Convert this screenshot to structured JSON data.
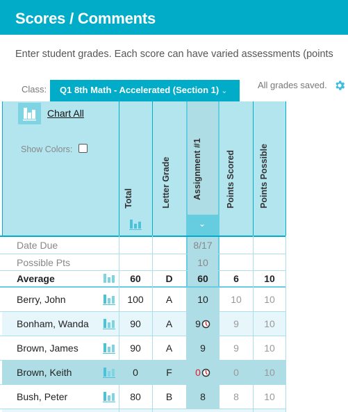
{
  "header": {
    "title": "Scores / Comments"
  },
  "intro_text": "Enter student grades. Each score can have varied assessments (points",
  "class_selector": {
    "label": "Class:",
    "value": "Q1 8th Math - Accelerated (Section 1)",
    "chevron": "chevron-down-icon"
  },
  "status": {
    "saved_text": "All grades saved.",
    "settings_icon": "gear-icon"
  },
  "toolbar": {
    "chart_all_label": "Chart All",
    "show_colors_label": "Show Colors:",
    "show_colors_checked": false
  },
  "columns": [
    {
      "key": "total",
      "label": "Total"
    },
    {
      "key": "letter",
      "label": "Letter Grade"
    },
    {
      "key": "assignment1",
      "label": "Assignment #1"
    },
    {
      "key": "scored",
      "label": "Points Scored"
    },
    {
      "key": "possible",
      "label": "Points Possible"
    }
  ],
  "meta_rows": [
    {
      "label": "Date Due",
      "assignment1": "8/17"
    },
    {
      "label": "Possible Pts",
      "assignment1": "10"
    }
  ],
  "average": {
    "label": "Average",
    "total": "60",
    "letter": "D",
    "assignment1": "60",
    "scored": "6",
    "possible": "10"
  },
  "students": [
    {
      "name": "Berry, John",
      "total": "100",
      "letter": "A",
      "assignment1": "10",
      "late": false,
      "scored": "10",
      "possible": "10"
    },
    {
      "name": "Bonham, Wanda",
      "total": "90",
      "letter": "A",
      "assignment1": "9",
      "late": true,
      "scored": "9",
      "possible": "10"
    },
    {
      "name": "Brown, James",
      "total": "90",
      "letter": "A",
      "assignment1": "9",
      "late": false,
      "scored": "9",
      "possible": "10"
    },
    {
      "name": "Brown, Keith",
      "total": "0",
      "letter": "F",
      "assignment1": "0",
      "late": true,
      "scored": "0",
      "possible": "10",
      "highlighted": true
    },
    {
      "name": "Bush, Peter",
      "total": "80",
      "letter": "B",
      "assignment1": "8",
      "late": false,
      "scored": "8",
      "possible": "10"
    }
  ],
  "colors": {
    "brand": "#00acc8",
    "header_bg": "#b3e5ef",
    "selected_col": "#aedde6",
    "alt_row": "#e6f6fa",
    "zero_score": "#e8192c"
  }
}
